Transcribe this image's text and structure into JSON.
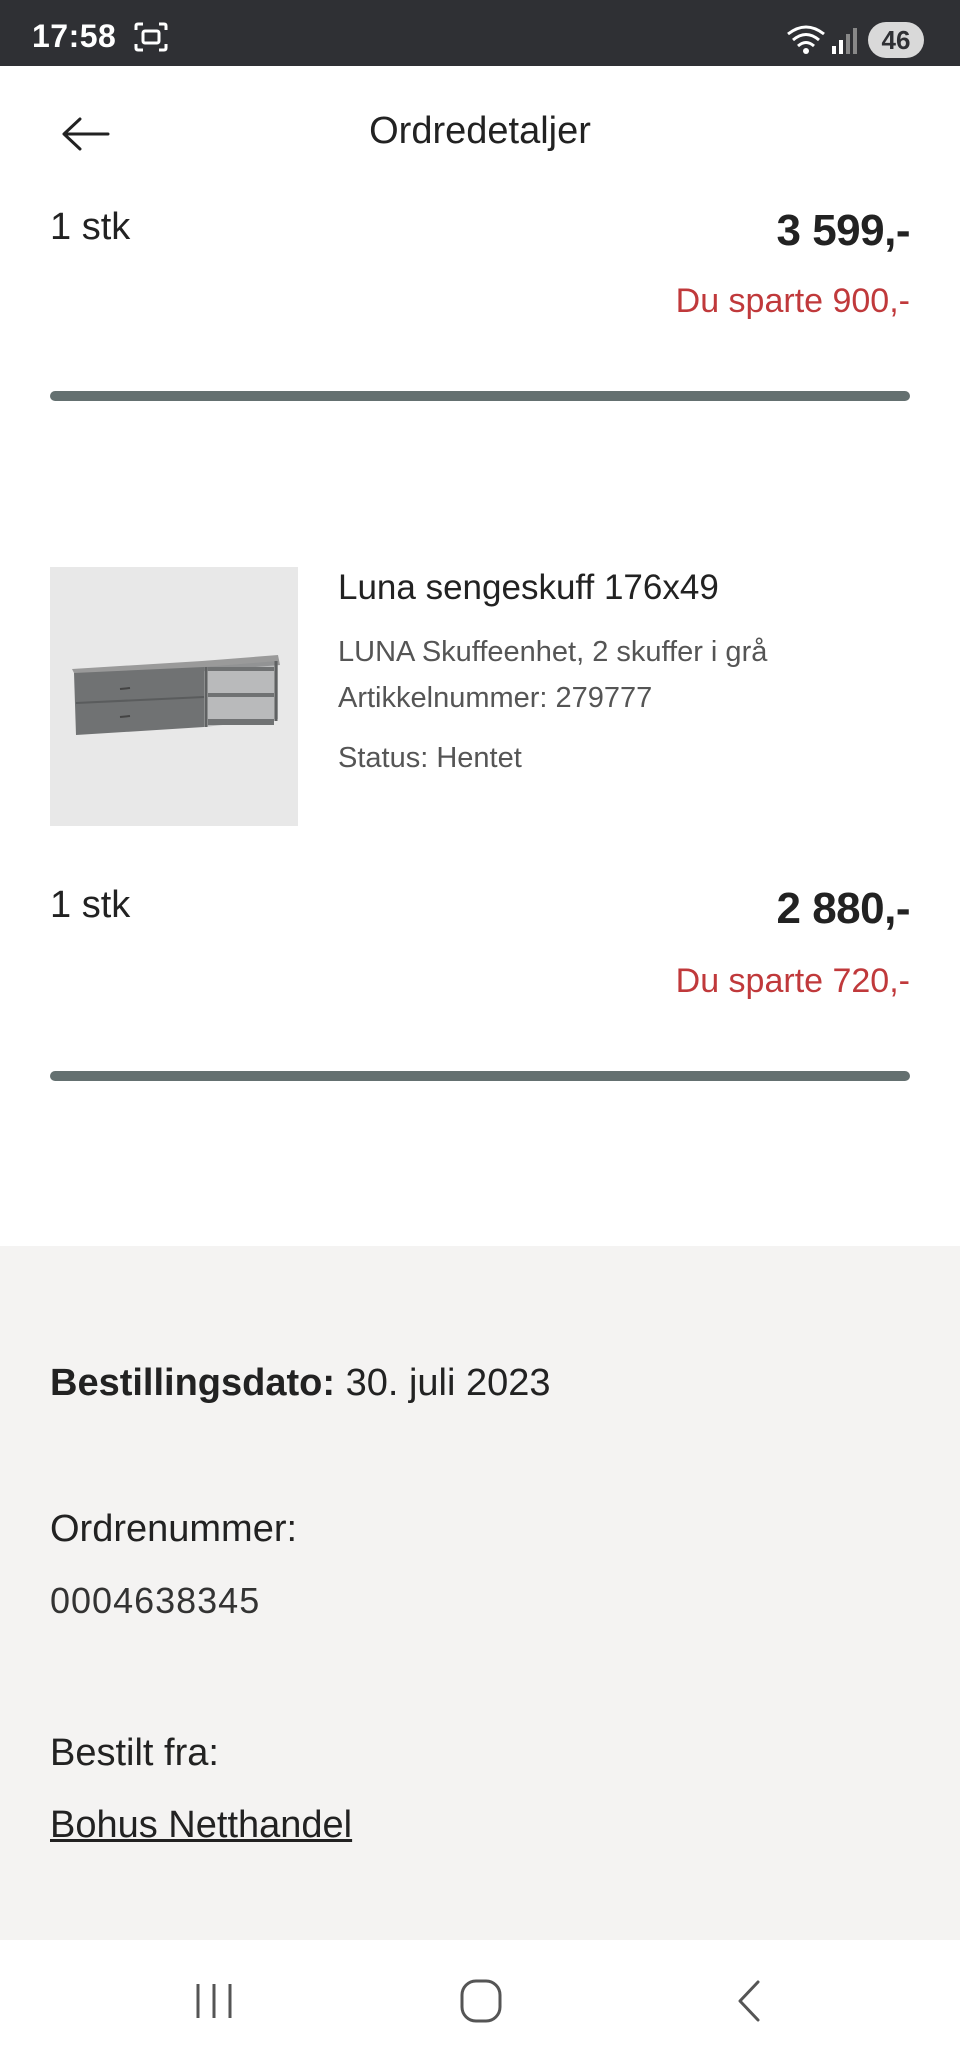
{
  "status_bar": {
    "time": "17:58",
    "battery": "46",
    "icons": [
      "screen-recorder-icon",
      "wifi-icon",
      "signal-icon",
      "battery-icon"
    ]
  },
  "header": {
    "title": "Ordredetaljer",
    "back_icon": "arrow-left-icon"
  },
  "items": [
    {
      "quantity": "1 stk",
      "price": "3 599,-",
      "savings": "Du sparte 900,-"
    },
    {
      "name": "Luna sengeskuff 176x49",
      "description": "LUNA Skuffeenhet, 2 skuffer i grå",
      "article": "Artikkelnummer: 279777",
      "status": "Status: Hentet",
      "image_icon": "drawer-unit-image",
      "quantity": "1 stk",
      "price": "2 880,-",
      "savings": "Du sparte 720,-"
    }
  ],
  "order": {
    "date_label": "Bestillingsdato:",
    "date_value": "30. juli 2023",
    "number_label": "Ordrenummer:",
    "number_value": "0004638345",
    "from_label": "Bestilt fra:",
    "from_value": "Bohus Netthandel"
  },
  "colors": {
    "accent_red": "#c0393b",
    "divider": "#647070",
    "status_bar": "#2f3034",
    "info_bg": "#f4f3f2"
  },
  "nav": {
    "icons": [
      "recent-apps-icon",
      "home-icon",
      "back-nav-icon"
    ]
  }
}
